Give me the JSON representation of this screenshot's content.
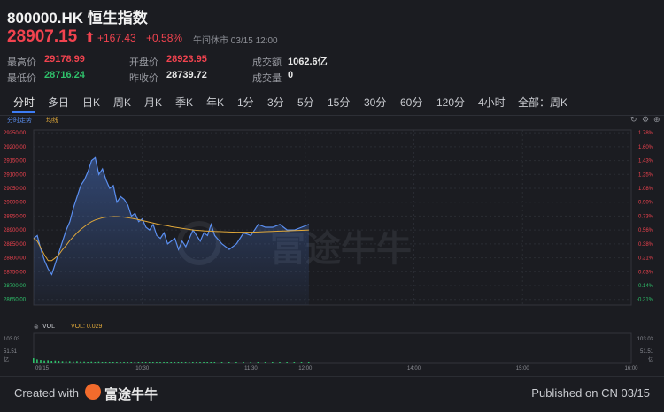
{
  "header": {
    "title": "800000.HK 恒生指数",
    "price": "28907.15",
    "change": "+167.43",
    "change_pct": "+0.58%",
    "status": "午间休市 03/15 12:00"
  },
  "stats": {
    "high_label": "最高价",
    "high": "29178.99",
    "open_label": "开盘价",
    "open": "28923.95",
    "turnover_label": "成交额",
    "turnover": "1062.6亿",
    "low_label": "最低价",
    "low": "28716.24",
    "prev_close_label": "昨收价",
    "prev_close": "28739.72",
    "volume_label": "成交量",
    "volume": "0"
  },
  "tabs": [
    "分时",
    "多日",
    "日K",
    "周K",
    "月K",
    "季K",
    "年K",
    "1分",
    "3分",
    "5分",
    "15分",
    "30分",
    "60分",
    "120分",
    "4小时",
    "全部：周K"
  ],
  "chart_labels": {
    "trend": "分时走势",
    "avg": "均线",
    "vol": "VOL",
    "vol_value": "VOL: 0.029",
    "watermark": "富途牛牛"
  },
  "footer": {
    "created": "Created with",
    "brand": "富途牛牛",
    "published": "Published on CN 03/15"
  },
  "colors": {
    "up": "#f2434f",
    "down": "#2fc26b",
    "price_line": "#5b8ff0",
    "avg_line": "#e0a83a",
    "background": "#1b1c21"
  },
  "chart_data": {
    "type": "line",
    "title": "",
    "prev_close": 28739.72,
    "y_ticks": [
      "29250.00",
      "29200.00",
      "29150.00",
      "29100.00",
      "29050.00",
      "29000.00",
      "28950.00",
      "28900.00",
      "28850.00",
      "28800.00",
      "28750.00",
      "28700.00",
      "28650.00"
    ],
    "y_pct_ticks": [
      "1.78%",
      "1.60%",
      "1.43%",
      "1.25%",
      "1.08%",
      "0.90%",
      "0.73%",
      "0.56%",
      "0.38%",
      "0.21%",
      "0.03%",
      "-0.14%",
      "-0.31%"
    ],
    "ylim": [
      28630,
      29260
    ],
    "x_ticks": [
      "09/15",
      "10:30",
      "11:30",
      "12:00",
      "14:00",
      "15:00",
      "16:00"
    ],
    "x_range": [
      0,
      330
    ],
    "series": [
      {
        "x": [
          0,
          2,
          4,
          6,
          8,
          10,
          12,
          14,
          16,
          18,
          20,
          22,
          24,
          26,
          28,
          30,
          32,
          34,
          36,
          38,
          40,
          42,
          44,
          46,
          48,
          50,
          52,
          54,
          56,
          58,
          60,
          62,
          64,
          66,
          68,
          70,
          72,
          74,
          76,
          78,
          80,
          82,
          84,
          86,
          88,
          90,
          92,
          94,
          96,
          98,
          100,
          104,
          108,
          112,
          116,
          120,
          124,
          128,
          132,
          136,
          140,
          144,
          148,
          152
        ],
        "values": [
          28870,
          28880,
          28830,
          28790,
          28760,
          28740,
          28780,
          28820,
          28860,
          28900,
          28930,
          28980,
          29020,
          29060,
          29080,
          29110,
          29150,
          29160,
          29100,
          29120,
          29080,
          29050,
          29060,
          29000,
          29020,
          29010,
          28990,
          28950,
          28960,
          28930,
          28940,
          28910,
          28900,
          28920,
          28880,
          28870,
          28890,
          28850,
          28860,
          28870,
          28830,
          28860,
          28840,
          28870,
          28900,
          28880,
          28860,
          28890,
          28880,
          28920,
          28880,
          28850,
          28830,
          28850,
          28890,
          28880,
          28920,
          28910,
          28910,
          28920,
          28900,
          28900,
          28910,
          28920
        ]
      },
      {
        "values": [
          28870,
          28860,
          28835,
          28810,
          28790,
          28790,
          28800,
          28812,
          28830,
          28845,
          28862,
          28876,
          28890,
          28902,
          28912,
          28922,
          28930,
          28936,
          28940,
          28944,
          28946,
          28947,
          28948,
          28948,
          28947,
          28946,
          28944,
          28942,
          28940,
          28937,
          28934,
          28931,
          28928,
          28925,
          28922,
          28919,
          28917,
          28915,
          28912,
          28910,
          28908,
          28906,
          28904,
          28902,
          28900,
          28899,
          28898,
          28897,
          28896,
          28896,
          28895,
          28894,
          28893,
          28892,
          28892,
          28892,
          28893,
          28894,
          28895,
          28896,
          28897,
          28898,
          28899,
          28900
        ]
      }
    ],
    "volume": {
      "ylim": [
        0,
        103.03
      ],
      "y_ticks": [
        "103.03",
        "51.51",
        "亿"
      ],
      "values": [
        18,
        14,
        12,
        10,
        11,
        9,
        10,
        9,
        8,
        8,
        8,
        7,
        8,
        7,
        7,
        6,
        7,
        6,
        7,
        6,
        6,
        6,
        5,
        6,
        5,
        5,
        5,
        6,
        5,
        5,
        5,
        4,
        5,
        5,
        4,
        4,
        5,
        4,
        4,
        4,
        4,
        4,
        4,
        4,
        4,
        4,
        4,
        4,
        4,
        4,
        4,
        4,
        4,
        4,
        4,
        4,
        4,
        4,
        4,
        4,
        4,
        4,
        4,
        6
      ]
    }
  }
}
